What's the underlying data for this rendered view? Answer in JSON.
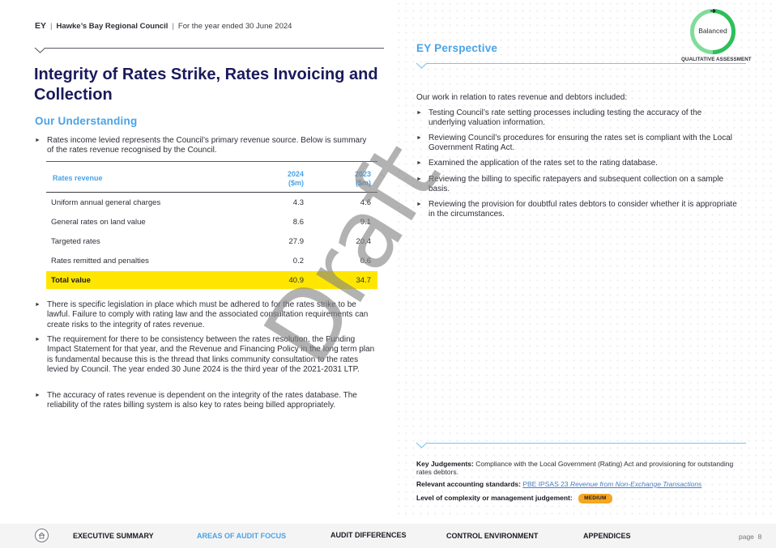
{
  "header": {
    "brand": "EY",
    "client": "Hawke’s Bay Regional Council",
    "period": "For the year ended 30 June 2024"
  },
  "title": "Integrity of Rates Strike, Rates Invoicing and Collection",
  "understanding": {
    "heading": "Our Understanding",
    "intro_bullet": "Rates income levied represents the Council’s primary revenue source.  Below is summary of the rates revenue recognised by the Council.",
    "table": {
      "label_header": "Rates revenue",
      "col_headers": [
        {
          "year": "2024",
          "unit": "($m)"
        },
        {
          "year": "2023",
          "unit": "($m)"
        }
      ],
      "rows": [
        {
          "label": "Uniform annual general charges",
          "v2024": "4.3",
          "v2023": "4.6"
        },
        {
          "label": "General rates on land value",
          "v2024": "8.6",
          "v2023": "9.1"
        },
        {
          "label": "Targeted rates",
          "v2024": "27.9",
          "v2023": "20.4"
        },
        {
          "label": "Rates remitted and penalties",
          "v2024": "0.2",
          "v2023": "0.6"
        }
      ],
      "total": {
        "label": "Total value",
        "v2024": "40.9",
        "v2023": "34.7"
      }
    },
    "bullets": [
      "There is specific legislation in place which must be adhered to for the rates strike to be lawful. Failure to comply with rating law and the associated consultation requirements can create risks to the integrity of rates revenue.",
      "The requirement for there to be consistency between the rates resolution, the Funding Impact Statement for that year, and the Revenue and Financing Policy in the long term plan is fundamental because this is the thread that links community consultation to the rates levied by Council. The year ended 30 June 2024 is the third year of the 2021-2031 LTP.",
      "The accuracy of rates revenue is dependent on the integrity of the rates database. The reliability of the rates billing system is also key to rates being billed appropriately."
    ]
  },
  "watermark": "Draft",
  "perspective": {
    "heading": "EY Perspective",
    "assessment": {
      "label": "Balanced",
      "caption": "QUALITATIVE ASSESSMENT",
      "icon": "arrow-right-icon",
      "colors": {
        "light": "#7fdc9a",
        "dark": "#2fbf5a"
      }
    },
    "intro": "Our work in relation to rates revenue and debtors included:",
    "bullets": [
      "Testing Council’s rate setting processes including testing the accuracy of the underlying valuation information.",
      "Reviewing Council’s procedures for ensuring the rates set is compliant with the Local Government Rating Act.",
      "Examined the application of the rates set to the rating database.",
      "Reviewing the billing to specific ratepayers and subsequent collection on a sample basis.",
      "Reviewing the provision for doubtful rates debtors to consider whether it is appropriate in the circumstances."
    ],
    "key_judgements_label": "Key Judgements:",
    "key_judgements": "Compliance with the Local Government (Rating) Act and provisioning for outstanding rates debtors.",
    "standards_label": "Relevant accounting standards:",
    "standards_code": "PBE IPSAS 23",
    "standards_title": "Revenue from Non-Exchange Transactions",
    "complexity_label": "Level of complexity or management judgement:",
    "complexity_value": "MEDIUM",
    "complexity_color": "#f5a623"
  },
  "footer": {
    "home_icon": "home-icon",
    "nav": [
      {
        "label": "EXECUTIVE SUMMARY",
        "active": false
      },
      {
        "label": "AREAS OF AUDIT FOCUS",
        "active": true
      },
      {
        "label": "AUDIT DIFFERENCES",
        "active": false
      },
      {
        "label": "CONTROL ENVIRONMENT",
        "active": false
      },
      {
        "label": "APPENDICES",
        "active": false
      }
    ],
    "page_label": "page",
    "page_number": "8"
  },
  "colors": {
    "title": "#1a1a5c",
    "accent_blue": "#4aa3e6",
    "highlight_yellow": "#ffe600"
  }
}
